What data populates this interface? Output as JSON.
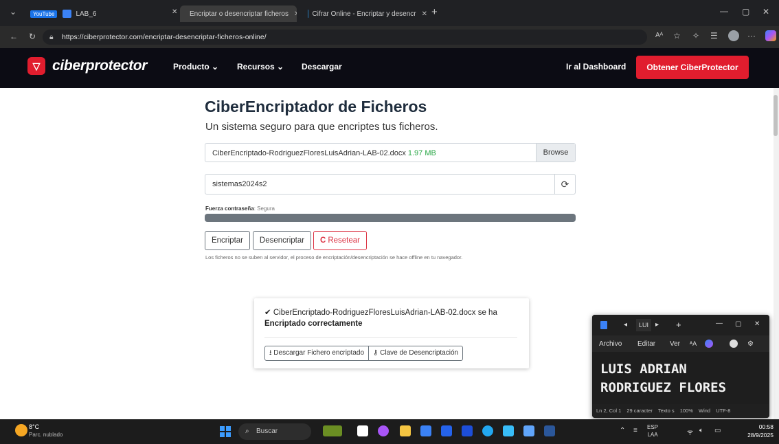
{
  "browser": {
    "tabs": [
      {
        "label": "LAB_6"
      },
      {
        "label": "Encriptar o desencriptar ficheros"
      },
      {
        "label": "Cifrar Online - Encriptar y desencr"
      }
    ],
    "youtube_badge": "YouTube",
    "url": "https://ciberprotector.com/encriptar-desencriptar-ficheros-online/"
  },
  "site": {
    "logo": "ciberprotector",
    "nav": [
      "Producto ⌄",
      "Recursos ⌄",
      "Descargar"
    ],
    "dashboard": "Ir al Dashboard",
    "cta": "Obtener CiberProtector"
  },
  "main": {
    "title": "CiberEncriptador de Ficheros",
    "subtitle": "Un sistema seguro para que encriptes tus ficheros.",
    "file_name": "CiberEncriptado-RodriguezFloresLuisAdrian-LAB-02.docx",
    "file_size": "1.97 MB",
    "browse": "Browse",
    "password": "sistemas2024s2",
    "strength_label": "Fuerza contraseña",
    "strength_value": ": Segura",
    "strength_level": 1.0,
    "buttons": {
      "encrypt": "Encriptar",
      "decrypt": "Desencriptar",
      "reset": "Resetear"
    },
    "note": "Los ficheros no se suben al servidor, el proceso de encriptación/desencriptación se hace offline en tu navegador."
  },
  "result": {
    "line1": "CiberEncriptado-RodriguezFloresLuisAdrian-LAB-02.docx se ha",
    "line2": "Encriptado correctamente",
    "download": "Descargar Fichero encriptado",
    "key": "Clave de Desencriptación"
  },
  "notepad": {
    "tab": "LUI",
    "menu": [
      "Archivo",
      "Editar",
      "Ver"
    ],
    "line1": "LUIS ADRIAN",
    "line2": "RODRIGUEZ FLORES",
    "status": [
      "Ln 2, Col 1",
      "29 caracter",
      "Texto s",
      "100%",
      "Wind",
      "UTF-8"
    ]
  },
  "taskbar": {
    "temp": "8°C",
    "weather": "Parc. nublado",
    "search": "Buscar",
    "lang1": "ESP",
    "lang2": "LAA",
    "time": "00:58",
    "date": "28/9/2025"
  },
  "colors": {
    "brand_red": "#e11d2e",
    "nav_dark": "#0c0c14",
    "success_green": "#28a745"
  }
}
